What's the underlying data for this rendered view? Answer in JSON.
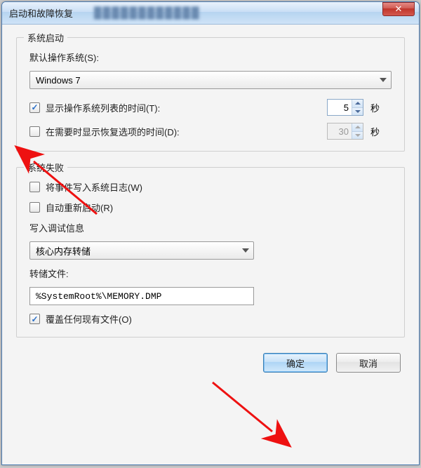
{
  "window": {
    "title": "启动和故障恢复",
    "close_glyph": "✕"
  },
  "startup": {
    "legend": "系统启动",
    "default_os_label": "默认操作系统(S):",
    "default_os_value": "Windows 7",
    "show_os_list_label": "显示操作系统列表的时间(T):",
    "show_os_list_value": "5",
    "show_recovery_label": "在需要时显示恢复选项的时间(D):",
    "show_recovery_value": "30",
    "seconds_unit": "秒"
  },
  "failure": {
    "legend": "系统失败",
    "write_event_label": "将事件写入系统日志(W)",
    "auto_restart_label": "自动重新启动(R)",
    "debug_info_label": "写入调试信息",
    "debug_info_value": "核心内存转储",
    "dump_file_label": "转储文件:",
    "dump_file_value": "%SystemRoot%\\MEMORY.DMP",
    "overwrite_label": "覆盖任何现有文件(O)"
  },
  "buttons": {
    "ok": "确定",
    "cancel": "取消"
  }
}
